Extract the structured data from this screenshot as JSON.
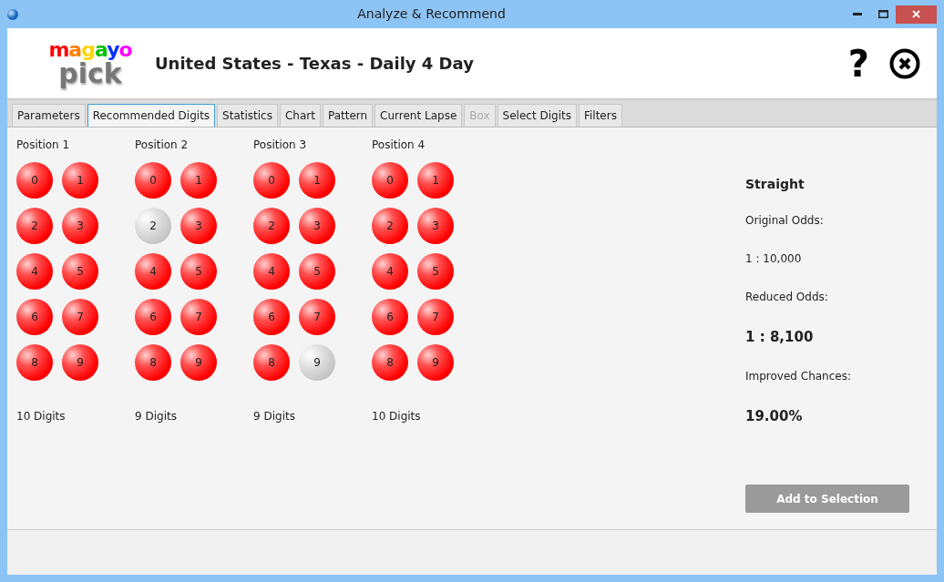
{
  "window": {
    "title": "Analyze & Recommend"
  },
  "logo": {
    "top": "magayo",
    "bottom": "pick"
  },
  "header": {
    "title": "United States - Texas - Daily 4 Day",
    "help": "?"
  },
  "tabs": [
    {
      "label": "Parameters",
      "selected": false,
      "disabled": false
    },
    {
      "label": "Recommended Digits",
      "selected": true,
      "disabled": false
    },
    {
      "label": "Statistics",
      "selected": false,
      "disabled": false
    },
    {
      "label": "Chart",
      "selected": false,
      "disabled": false
    },
    {
      "label": "Pattern",
      "selected": false,
      "disabled": false
    },
    {
      "label": "Current Lapse",
      "selected": false,
      "disabled": false
    },
    {
      "label": "Box",
      "selected": false,
      "disabled": true
    },
    {
      "label": "Select Digits",
      "selected": false,
      "disabled": false
    },
    {
      "label": "Filters",
      "selected": false,
      "disabled": false
    }
  ],
  "positions": [
    {
      "title": "Position 1",
      "count": "10 Digits",
      "digits": [
        {
          "label": "0",
          "selected": true
        },
        {
          "label": "1",
          "selected": true
        },
        {
          "label": "2",
          "selected": true
        },
        {
          "label": "3",
          "selected": true
        },
        {
          "label": "4",
          "selected": true
        },
        {
          "label": "5",
          "selected": true
        },
        {
          "label": "6",
          "selected": true
        },
        {
          "label": "7",
          "selected": true
        },
        {
          "label": "8",
          "selected": true
        },
        {
          "label": "9",
          "selected": true
        }
      ]
    },
    {
      "title": "Position 2",
      "count": "9 Digits",
      "digits": [
        {
          "label": "0",
          "selected": true
        },
        {
          "label": "1",
          "selected": true
        },
        {
          "label": "2",
          "selected": false
        },
        {
          "label": "3",
          "selected": true
        },
        {
          "label": "4",
          "selected": true
        },
        {
          "label": "5",
          "selected": true
        },
        {
          "label": "6",
          "selected": true
        },
        {
          "label": "7",
          "selected": true
        },
        {
          "label": "8",
          "selected": true
        },
        {
          "label": "9",
          "selected": true
        }
      ]
    },
    {
      "title": "Position 3",
      "count": "9 Digits",
      "digits": [
        {
          "label": "0",
          "selected": true
        },
        {
          "label": "1",
          "selected": true
        },
        {
          "label": "2",
          "selected": true
        },
        {
          "label": "3",
          "selected": true
        },
        {
          "label": "4",
          "selected": true
        },
        {
          "label": "5",
          "selected": true
        },
        {
          "label": "6",
          "selected": true
        },
        {
          "label": "7",
          "selected": true
        },
        {
          "label": "8",
          "selected": true
        },
        {
          "label": "9",
          "selected": false
        }
      ]
    },
    {
      "title": "Position 4",
      "count": "10 Digits",
      "digits": [
        {
          "label": "0",
          "selected": true
        },
        {
          "label": "1",
          "selected": true
        },
        {
          "label": "2",
          "selected": true
        },
        {
          "label": "3",
          "selected": true
        },
        {
          "label": "4",
          "selected": true
        },
        {
          "label": "5",
          "selected": true
        },
        {
          "label": "6",
          "selected": true
        },
        {
          "label": "7",
          "selected": true
        },
        {
          "label": "8",
          "selected": true
        },
        {
          "label": "9",
          "selected": true
        }
      ]
    }
  ],
  "summary": [
    {
      "kind": "heading",
      "text": "Straight"
    },
    {
      "kind": "label",
      "text": "Original Odds:"
    },
    {
      "kind": "value",
      "text": "1 : 10,000"
    },
    {
      "kind": "label",
      "text": "Reduced Odds:"
    },
    {
      "kind": "big",
      "text": "1 : 8,100"
    },
    {
      "kind": "label",
      "text": "Improved Chances:"
    },
    {
      "kind": "big",
      "text": "19.00%"
    }
  ],
  "add_button": {
    "label": "Add to Selection",
    "disabled": true
  }
}
